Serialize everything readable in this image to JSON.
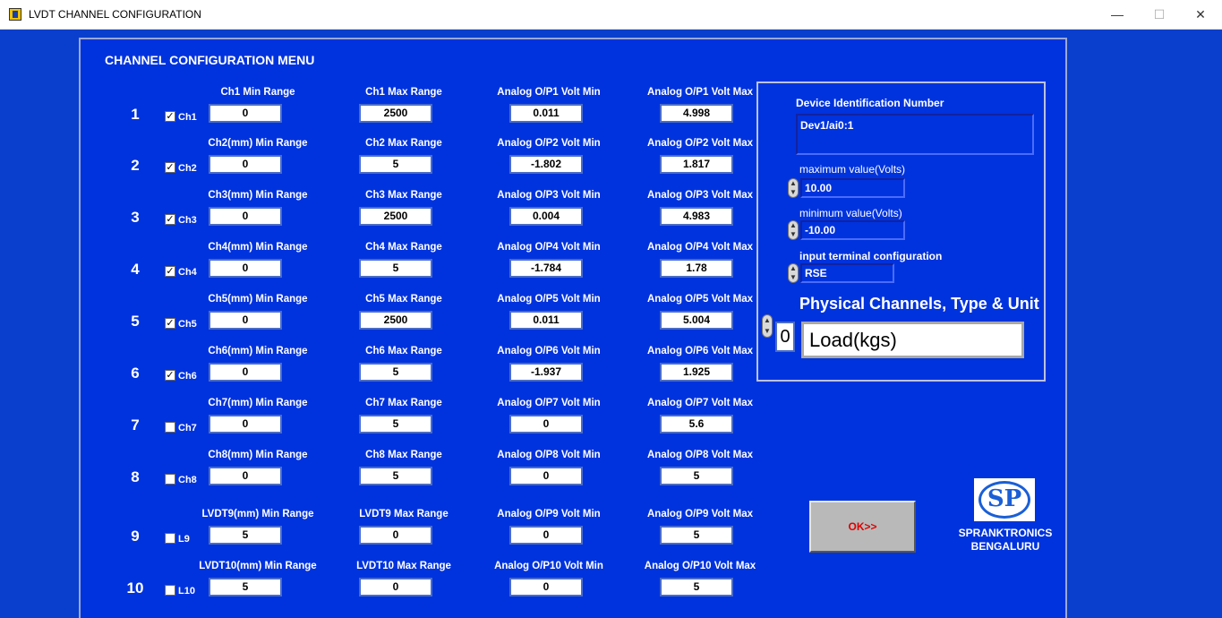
{
  "window": {
    "title": "LVDT CHANNEL CONFIGURATION",
    "min_label": "—",
    "max_label": "☐",
    "close_label": "✕"
  },
  "menu_title": "CHANNEL CONFIGURATION MENU",
  "channels": [
    {
      "num": "1",
      "checked": true,
      "check_label": "Ch1",
      "min_label": "Ch1  Min Range",
      "min_value": "0",
      "max_label": "Ch1  Max Range",
      "max_value": "2500",
      "vmin_label": "Analog O/P1 Volt Min",
      "vmin_value": "0.011",
      "vmax_label": "Analog O/P1 Volt Max",
      "vmax_value": "4.998"
    },
    {
      "num": "2",
      "checked": true,
      "check_label": "Ch2",
      "min_label": "Ch2(mm) Min Range",
      "min_value": "0",
      "max_label": "Ch2 Max Range",
      "max_value": "5",
      "vmin_label": "Analog O/P2 Volt Min",
      "vmin_value": "-1.802",
      "vmax_label": "Analog O/P2 Volt Max",
      "vmax_value": "1.817"
    },
    {
      "num": "3",
      "checked": true,
      "check_label": "Ch3",
      "min_label": "Ch3(mm) Min Range",
      "min_value": "0",
      "max_label": "Ch3 Max Range",
      "max_value": "2500",
      "vmin_label": "Analog O/P3 Volt Min",
      "vmin_value": "0.004",
      "vmax_label": "Analog O/P3 Volt Max",
      "vmax_value": "4.983"
    },
    {
      "num": "4",
      "checked": true,
      "check_label": "Ch4",
      "min_label": "Ch4(mm) Min Range",
      "min_value": "0",
      "max_label": "Ch4 Max Range",
      "max_value": "5",
      "vmin_label": "Analog O/P4 Volt Min",
      "vmin_value": "-1.784",
      "vmax_label": "Analog O/P4 Volt Max",
      "vmax_value": "1.78"
    },
    {
      "num": "5",
      "checked": true,
      "check_label": "Ch5",
      "min_label": "Ch5(mm) Min Range",
      "min_value": "0",
      "max_label": "Ch5  Max Range",
      "max_value": "2500",
      "vmin_label": "Analog O/P5 Volt Min",
      "vmin_value": "0.011",
      "vmax_label": "Analog O/P5 Volt Max",
      "vmax_value": "5.004"
    },
    {
      "num": "6",
      "checked": true,
      "check_label": "Ch6",
      "min_label": "Ch6(mm) Min Range",
      "min_value": "0",
      "max_label": "Ch6  Max Range",
      "max_value": "5",
      "vmin_label": "Analog O/P6 Volt Min",
      "vmin_value": "-1.937",
      "vmax_label": "Analog O/P6 Volt Max",
      "vmax_value": "1.925"
    },
    {
      "num": "7",
      "checked": false,
      "check_label": "Ch7",
      "min_label": "Ch7(mm) Min Range",
      "min_value": "0",
      "max_label": "Ch7  Max Range",
      "max_value": "5",
      "vmin_label": "Analog O/P7 Volt Min",
      "vmin_value": "0",
      "vmax_label": "Analog O/P7 Volt Max",
      "vmax_value": "5.6"
    },
    {
      "num": "8",
      "checked": false,
      "check_label": "Ch8",
      "min_label": "Ch8(mm) Min Range",
      "min_value": "0",
      "max_label": "Ch8  Max Range",
      "max_value": "5",
      "vmin_label": "Analog O/P8 Volt Min",
      "vmin_value": "0",
      "vmax_label": "Analog O/P8 Volt Max",
      "vmax_value": "5"
    },
    {
      "num": "9",
      "checked": false,
      "check_label": "L9",
      "min_label": "LVDT9(mm) Min Range",
      "min_value": "5",
      "max_label": "LVDT9  Max Range",
      "max_value": "0",
      "vmin_label": "Analog O/P9 Volt Min",
      "vmin_value": "0",
      "vmax_label": "Analog O/P9 Volt Max",
      "vmax_value": "5"
    },
    {
      "num": "10",
      "checked": false,
      "check_label": "L10",
      "min_label": "LVDT10(mm) Min Range",
      "min_value": "5",
      "max_label": "LVDT10  Max Range",
      "max_value": "0",
      "vmin_label": "Analog O/P10 Volt Min",
      "vmin_value": "0",
      "vmax_label": "Analog O/P10 Volt Max",
      "vmax_value": "5"
    }
  ],
  "daq": {
    "device_label": "Device Identification  Number",
    "device_value": "Dev1/ai0:1",
    "max_label": "maximum value(Volts)",
    "max_value": "10.00",
    "min_label": "minimum value(Volts)",
    "min_value": "-10.00",
    "terminal_label": "input terminal configuration",
    "terminal_value": "RSE",
    "phys_title": "Physical Channels, Type & Unit",
    "phys_index": "0",
    "phys_value": "Load(kgs)"
  },
  "ok_label": "OK>>",
  "logo_text": "SP",
  "company": {
    "line1": "SPRANKTRONICS",
    "line2": "BENGALURU"
  },
  "colors": {
    "background": "#0033dd",
    "ok_text": "#e00000"
  }
}
